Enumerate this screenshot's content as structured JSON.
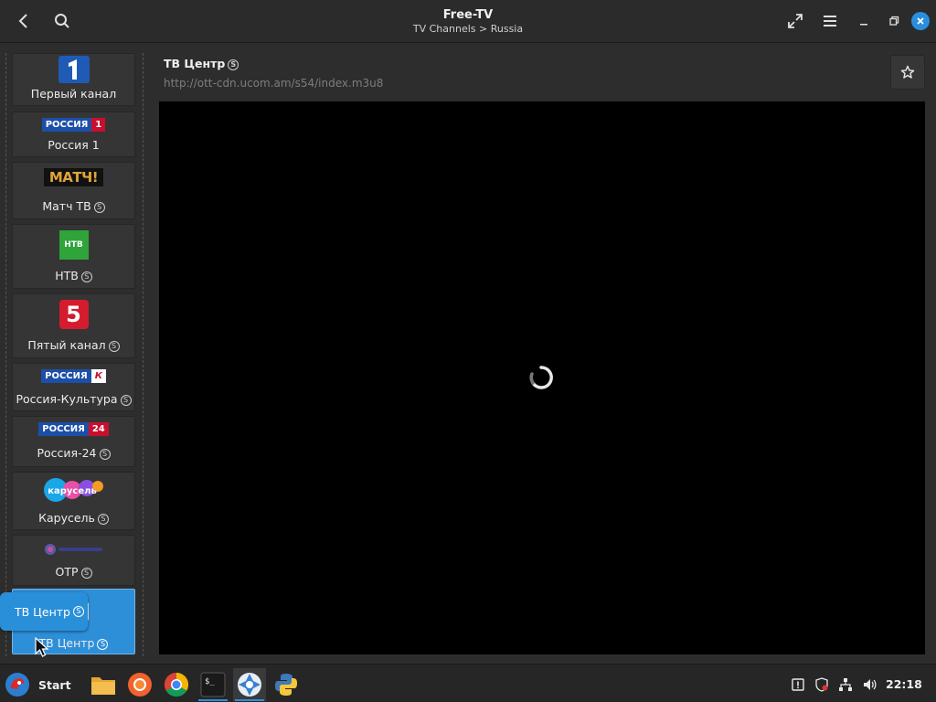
{
  "window": {
    "title": "Free-TV",
    "subtitle": "TV Channels > Russia"
  },
  "channels": [
    {
      "name": "Первый канал",
      "streaming_mark": false,
      "logo": "channel-one-logo"
    },
    {
      "name": "Россия 1",
      "streaming_mark": false,
      "logo": "russia-1-logo",
      "logo_text": "РОССИЯ",
      "logo_num": "1"
    },
    {
      "name": "Матч ТВ",
      "streaming_mark": true,
      "logo": "match-tv-logo",
      "logo_text": "МАТЧ!"
    },
    {
      "name": "НТВ",
      "streaming_mark": true,
      "logo": "ntv-logo",
      "logo_text": "НТВ"
    },
    {
      "name": "Пятый канал",
      "streaming_mark": true,
      "logo": "channel-5-logo",
      "logo_text": "5"
    },
    {
      "name": "Россия-Культура",
      "streaming_mark": true,
      "logo": "russia-k-logo",
      "logo_text": "РОССИЯ",
      "logo_num": "К"
    },
    {
      "name": "Россия-24",
      "streaming_mark": true,
      "logo": "russia-24-logo",
      "logo_text": "РОССИЯ",
      "logo_num": "24"
    },
    {
      "name": "Карусель",
      "streaming_mark": true,
      "logo": "karusel-logo",
      "logo_text": "карусель"
    },
    {
      "name": "ОТР",
      "streaming_mark": true,
      "logo": "otr-logo"
    },
    {
      "name": "ТВ Центр",
      "streaming_mark": true,
      "logo": "tv-centr-logo",
      "selected": true
    }
  ],
  "drag_tooltip": {
    "label": "ТВ Центр"
  },
  "main": {
    "channel_title": "ТВ Центр",
    "stream_url": "http://ott-cdn.ucom.am/s54/index.m3u8",
    "player_state": "loading"
  },
  "taskbar": {
    "start_label": "Start",
    "clock": "22:18",
    "apps": [
      "file-manager",
      "firefox",
      "chrome",
      "terminal",
      "free-tv",
      "python"
    ],
    "tray": [
      "update-notifier",
      "security-shield",
      "network",
      "volume"
    ]
  },
  "colors": {
    "accent": "#2a8fd9",
    "background": "#2d2d2d",
    "player": "#000000"
  }
}
